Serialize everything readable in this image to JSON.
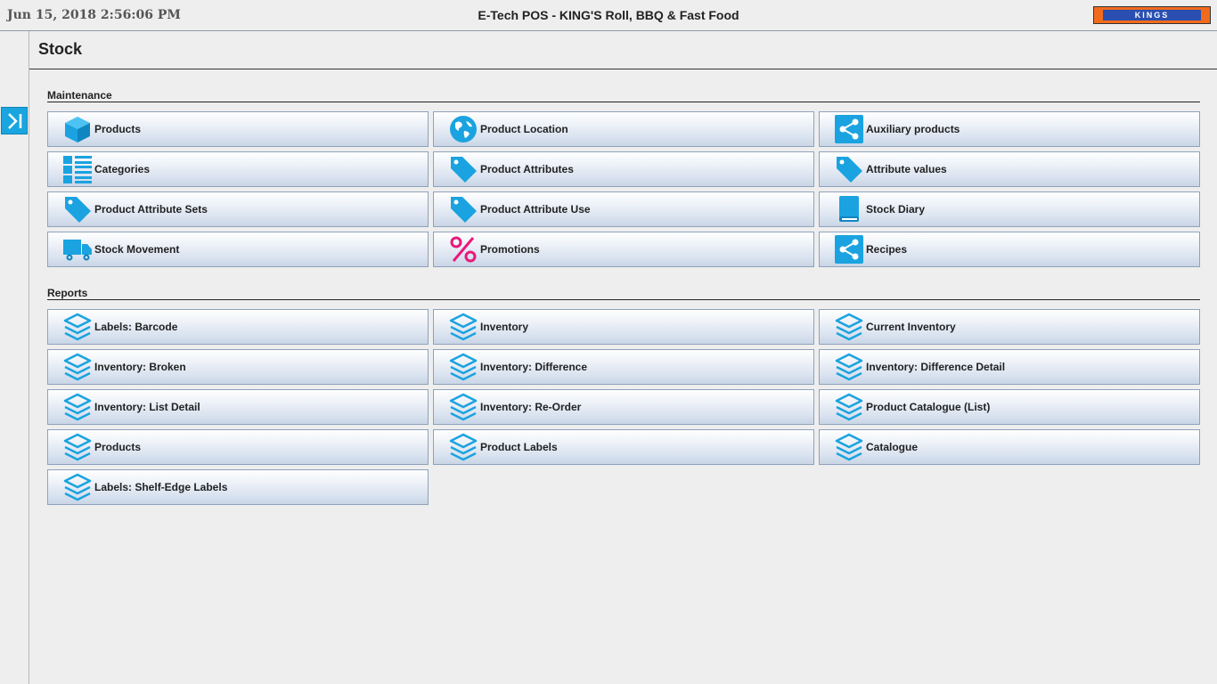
{
  "header": {
    "datetime": "Jun 15, 2018  2:56:06 PM",
    "app_title": "E-Tech POS - KING'S Roll, BBQ & Fast Food",
    "logo_text": "KINGS",
    "logo_colors": {
      "outer": "#f26b1d",
      "inner": "#2a4fb0"
    }
  },
  "page": {
    "title": "Stock"
  },
  "sidebar": {
    "toggle_icon": "expand-panel-icon"
  },
  "sections": {
    "maintenance": {
      "title": "Maintenance",
      "items": [
        {
          "label": "Products",
          "icon": "box-icon"
        },
        {
          "label": "Product Location",
          "icon": "globe-icon"
        },
        {
          "label": "Auxiliary products",
          "icon": "share-icon"
        },
        {
          "label": "Categories",
          "icon": "list-icon"
        },
        {
          "label": "Product Attributes",
          "icon": "tag-icon"
        },
        {
          "label": "Attribute values",
          "icon": "tag-icon"
        },
        {
          "label": "Product Attribute Sets",
          "icon": "tag-icon"
        },
        {
          "label": "Product Attribute Use",
          "icon": "tag-icon"
        },
        {
          "label": "Stock Diary",
          "icon": "book-icon"
        },
        {
          "label": "Stock Movement",
          "icon": "truck-icon"
        },
        {
          "label": "Promotions",
          "icon": "percent-icon"
        },
        {
          "label": "Recipes",
          "icon": "share-icon"
        }
      ]
    },
    "reports": {
      "title": "Reports",
      "items": [
        {
          "label": "Labels: Barcode",
          "icon": "layers-icon"
        },
        {
          "label": "Inventory",
          "icon": "layers-icon"
        },
        {
          "label": "Current Inventory",
          "icon": "layers-icon"
        },
        {
          "label": "Inventory: Broken",
          "icon": "layers-icon"
        },
        {
          "label": "Inventory: Difference",
          "icon": "layers-icon"
        },
        {
          "label": "Inventory: Difference Detail",
          "icon": "layers-icon"
        },
        {
          "label": "Inventory: List Detail",
          "icon": "layers-icon"
        },
        {
          "label": "Inventory: Re-Order",
          "icon": "layers-icon"
        },
        {
          "label": "Product Catalogue (List)",
          "icon": "layers-icon"
        },
        {
          "label": "Products",
          "icon": "layers-icon"
        },
        {
          "label": "Product Labels",
          "icon": "layers-icon"
        },
        {
          "label": "Catalogue",
          "icon": "layers-icon"
        },
        {
          "label": "Labels: Shelf-Edge Labels",
          "icon": "layers-icon"
        }
      ]
    }
  },
  "colors": {
    "icon_blue": "#1aa3e0",
    "icon_pink": "#e8197a",
    "background": "#eeeeee"
  }
}
